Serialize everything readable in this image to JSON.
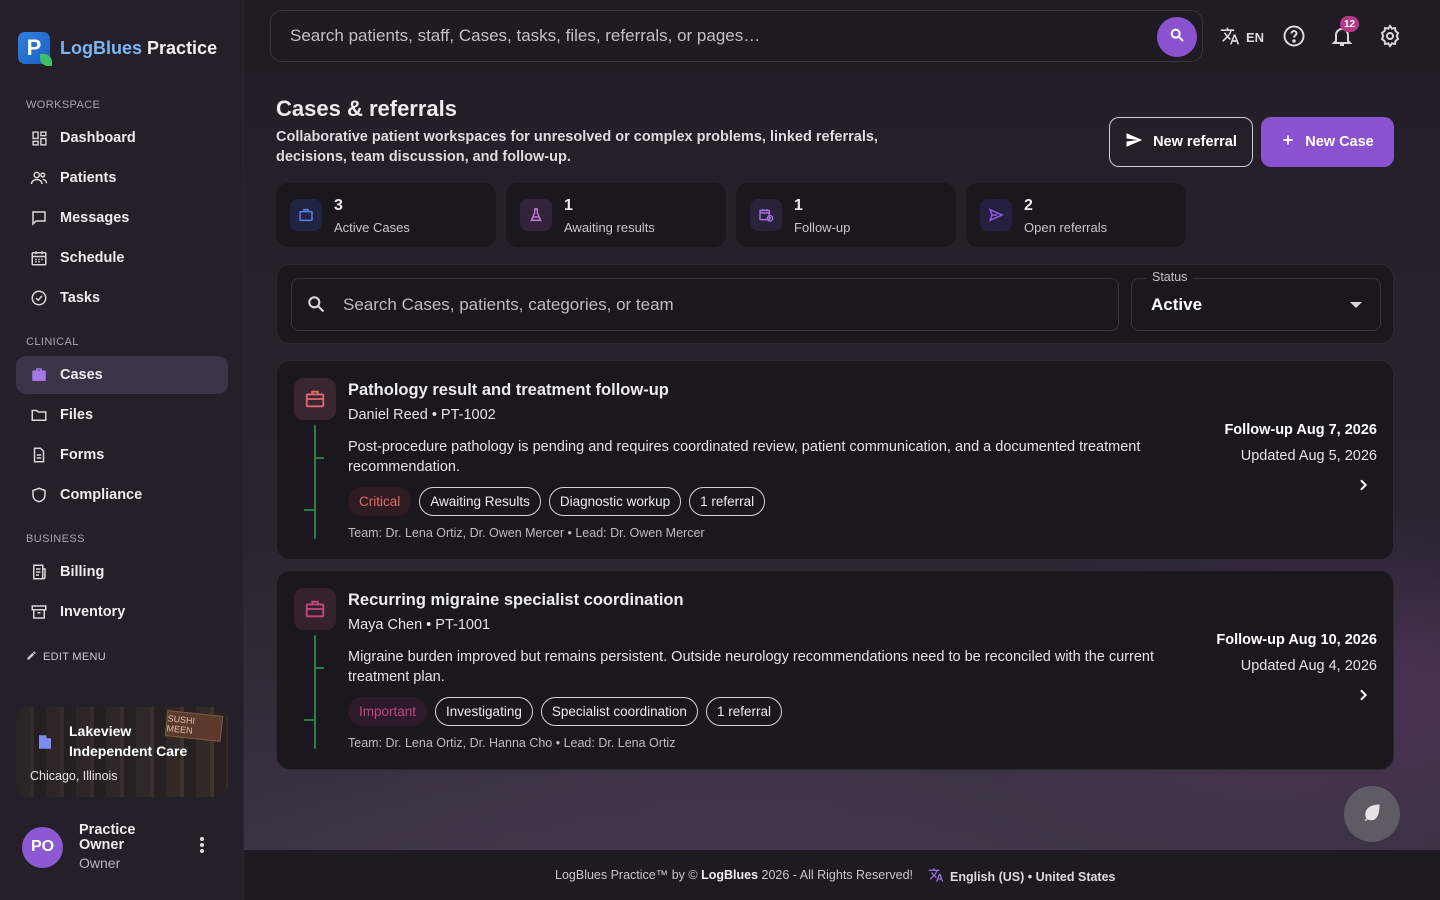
{
  "brand": {
    "name_part1": "LogBlues",
    "name_part2": "Practice",
    "logo_letter": "P"
  },
  "colors": {
    "accent": "#8b52cf",
    "critical": "#e0686e",
    "important": "#c4467f",
    "badge": "#b43a87"
  },
  "sidebar": {
    "sections": {
      "workspace": "WORKSPACE",
      "clinical": "CLINICAL",
      "business": "BUSINESS"
    },
    "workspace_items": [
      {
        "label": "Dashboard",
        "icon": "dashboard-icon"
      },
      {
        "label": "Patients",
        "icon": "users-icon"
      },
      {
        "label": "Messages",
        "icon": "chat-icon"
      },
      {
        "label": "Schedule",
        "icon": "calendar-icon"
      },
      {
        "label": "Tasks",
        "icon": "check-circle-icon"
      }
    ],
    "clinical_items": [
      {
        "label": "Cases",
        "icon": "briefcase-icon",
        "active": true
      },
      {
        "label": "Files",
        "icon": "folder-icon"
      },
      {
        "label": "Forms",
        "icon": "document-icon"
      },
      {
        "label": "Compliance",
        "icon": "shield-icon"
      }
    ],
    "business_items": [
      {
        "label": "Billing",
        "icon": "receipt-icon"
      },
      {
        "label": "Inventory",
        "icon": "archive-icon"
      }
    ],
    "edit_menu": "EDIT MENU",
    "clinic": {
      "name": "Lakeview Independent Care",
      "location": "Chicago, Illinois",
      "sign_text": "SUSHI MEEN"
    },
    "user": {
      "initials": "PO",
      "name": "Practice Owner",
      "role": "Owner"
    }
  },
  "topbar": {
    "search_placeholder": "Search patients, staff, Cases, tasks, files, referrals, or pages…",
    "lang_code": "EN",
    "notification_count": "12"
  },
  "page": {
    "title": "Cases & referrals",
    "subtitle": "Collaborative patient workspaces for unresolved or complex problems, linked referrals, decisions, team discussion, and follow-up.",
    "new_referral_label": "New referral",
    "new_case_label": "New Case"
  },
  "stats": [
    {
      "value": "3",
      "label": "Active Cases",
      "icon": "briefcase-icon",
      "color": "#5b7fe6",
      "bg": "#1f2440"
    },
    {
      "value": "1",
      "label": "Awaiting results",
      "icon": "flask-icon",
      "color": "#c67cd9",
      "bg": "#33233a"
    },
    {
      "value": "1",
      "label": "Follow-up",
      "icon": "calendar-clock-icon",
      "color": "#9d6fe0",
      "bg": "#2a2238"
    },
    {
      "value": "2",
      "label": "Open referrals",
      "icon": "send-icon",
      "color": "#8a5fe0",
      "bg": "#262040"
    }
  ],
  "filter": {
    "search_placeholder": "Search Cases, patients, categories, or team",
    "status_label": "Status",
    "status_value": "Active"
  },
  "cases": [
    {
      "title": "Pathology result and treatment follow-up",
      "patient": "Daniel Reed • PT-1002",
      "description": "Post-procedure pathology is pending and requires coordinated review, patient communication, and a documented treatment recommendation.",
      "priority": "Critical",
      "tags": [
        "Awaiting Results",
        "Diagnostic workup",
        "1 referral"
      ],
      "team": "Team: Dr. Lena Ortiz, Dr. Owen Mercer • Lead: Dr. Owen Mercer",
      "follow_up": "Follow-up Aug 7, 2026",
      "updated": "Updated Aug 5, 2026",
      "icon_color": "#e0686e",
      "icon_bg": "#3a2630"
    },
    {
      "title": "Recurring migraine specialist coordination",
      "patient": "Maya Chen • PT-1001",
      "description": "Migraine burden improved but remains persistent. Outside neurology recommendations need to be reconciled with the current treatment plan.",
      "priority": "Important",
      "tags": [
        "Investigating",
        "Specialist coordination",
        "1 referral"
      ],
      "team": "Team: Dr. Lena Ortiz, Dr. Hanna Cho • Lead: Dr. Lena Ortiz",
      "follow_up": "Follow-up Aug 10, 2026",
      "updated": "Updated Aug 4, 2026",
      "icon_color": "#c4467f",
      "icon_bg": "#36222f"
    }
  ],
  "footer": {
    "copy_prefix": "LogBlues Practice™ by ©",
    "copy_brand": "LogBlues",
    "copy_suffix": "2026 - All Rights Reserved!",
    "locale": "English (US) • United States"
  }
}
